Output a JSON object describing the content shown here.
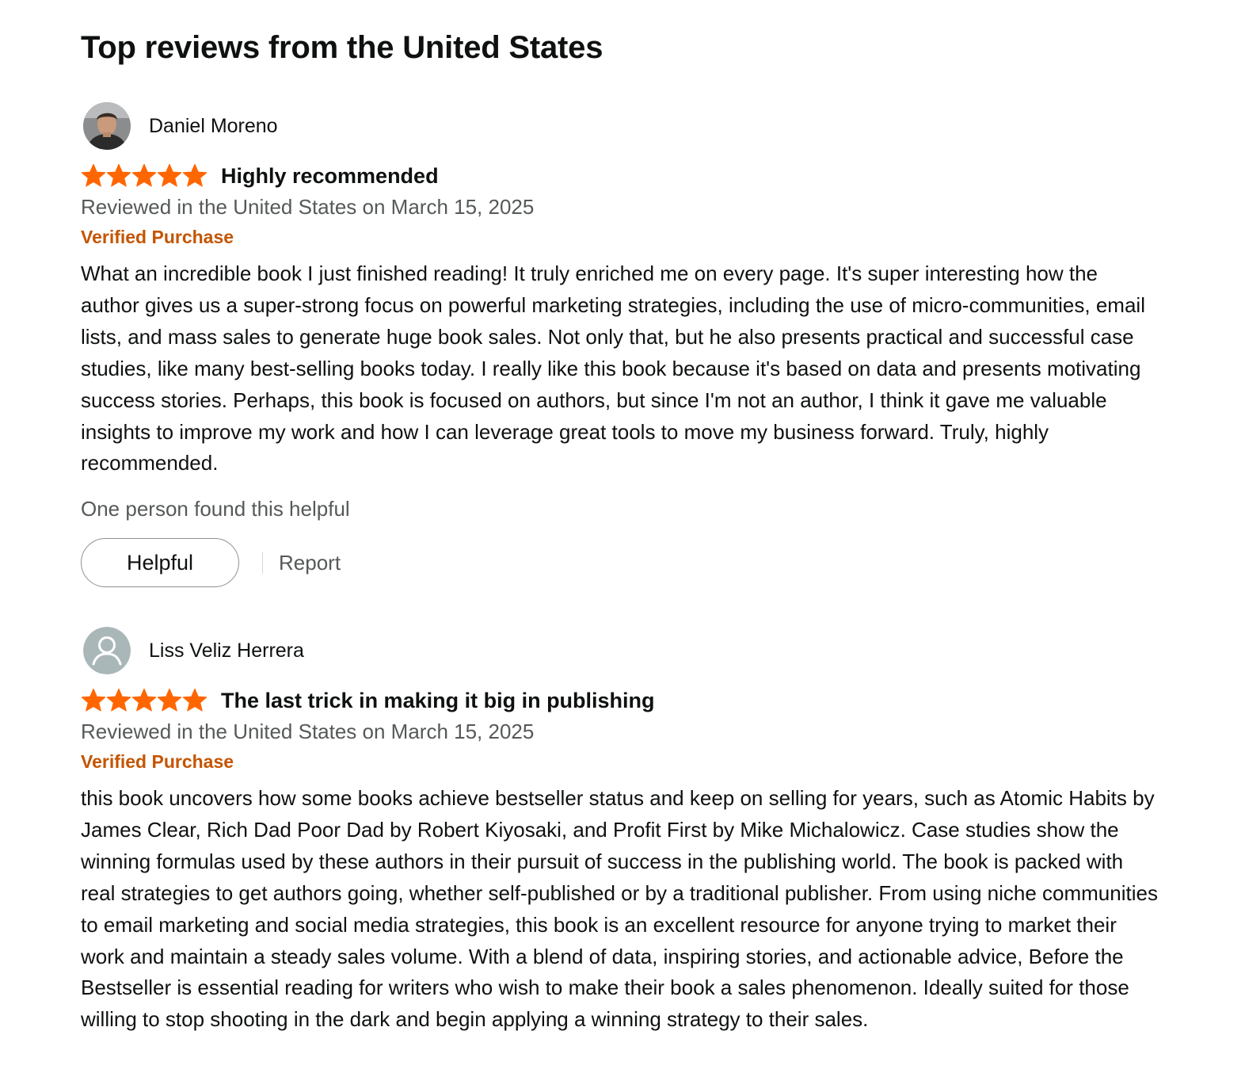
{
  "section_title": "Top reviews from the United States",
  "colors": {
    "star": "#ff6600",
    "verified": "#c45500",
    "secondary_text": "#565959",
    "primary_text": "#0f1111"
  },
  "reviews": [
    {
      "profile_name": "Daniel Moreno",
      "avatar": "profile-photo",
      "rating": 5,
      "rating_max": 5,
      "title": "Highly recommended",
      "date_text": "Reviewed in the United States on March 15, 2025",
      "verified_label": "Verified Purchase",
      "body": "What an incredible book I just finished reading! It truly enriched me on every page. It's super interesting how the author gives us a super-strong focus on powerful marketing strategies, including the use of micro-communities, email lists, and mass sales to generate huge book sales. Not only that, but he also presents practical and successful case studies, like many best-selling books today. I really like this book because it's based on data and presents motivating success stories. Perhaps, this book is focused on authors, but since I'm not an author, I think it gave me valuable insights to improve my work and how I can leverage great tools to move my business forward. Truly, highly recommended.",
      "helpful_count_text": "One person found this helpful",
      "helpful_button_label": "Helpful",
      "report_label": "Report"
    },
    {
      "profile_name": "Liss Veliz Herrera",
      "avatar": "default-user-icon",
      "rating": 5,
      "rating_max": 5,
      "title": "The last trick in making it big in publishing",
      "date_text": "Reviewed in the United States on March 15, 2025",
      "verified_label": "Verified Purchase",
      "body": "this book uncovers how some books achieve bestseller status and keep on selling for years, such as Atomic Habits by James Clear, Rich Dad Poor Dad by Robert Kiyosaki, and Profit First by Mike Michalowicz. Case studies show the winning formulas used by these authors in their pursuit of success in the publishing world. The book is packed with real strategies to get authors going, whether self-published or by a traditional publisher. From using niche communities to email marketing and social media strategies, this book is an excellent resource for anyone trying to market their work and maintain a steady sales volume. With a blend of data, inspiring stories, and actionable advice, Before the Bestseller is essential reading for writers who wish to make their book a sales phenomenon. Ideally suited for those willing to stop shooting in the dark and begin applying a winning strategy to their sales."
    }
  ]
}
